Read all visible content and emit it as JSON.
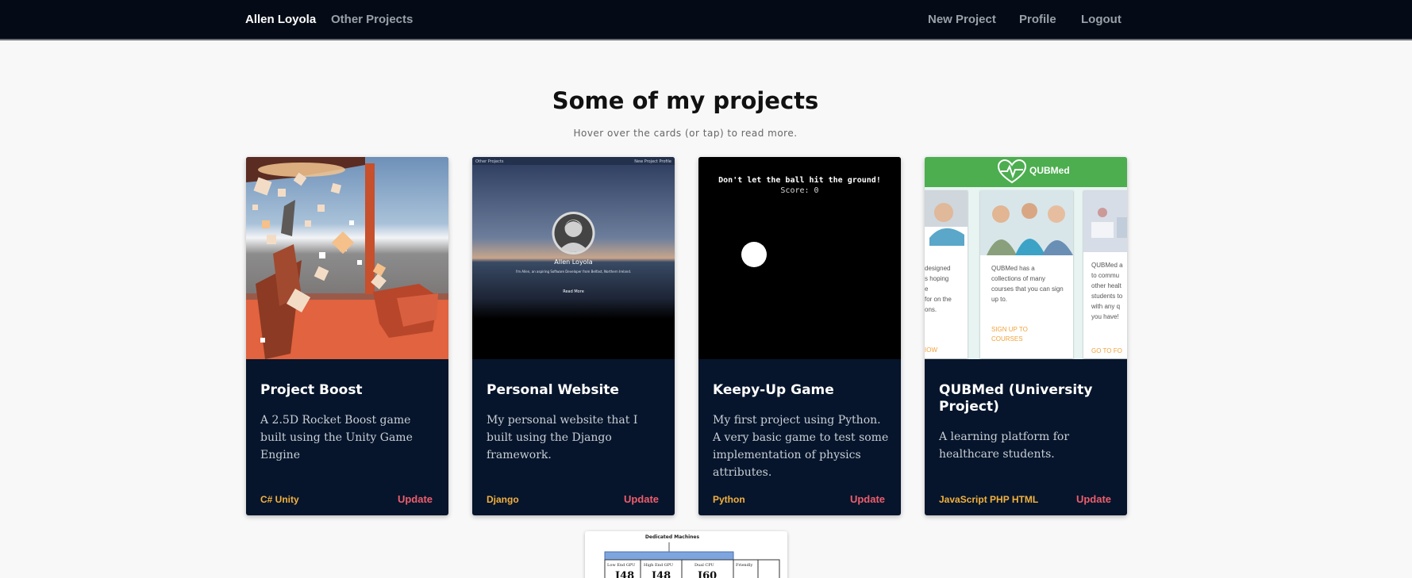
{
  "nav": {
    "brand": "Allen Loyola",
    "other_projects": "Other Projects",
    "new_project": "New Project",
    "profile": "Profile",
    "logout": "Logout"
  },
  "section": {
    "title": "Some of my projects",
    "subtitle": "Hover over the cards (or tap) to read more."
  },
  "cards": [
    {
      "title": "Project Boost",
      "description": "A 2.5D Rocket Boost game built using the Unity Game Engine",
      "tags": "C# Unity",
      "update": "Update"
    },
    {
      "title": "Personal Website",
      "description": "My personal website that I built using the Django framework.",
      "tags": "Django",
      "update": "Update",
      "preview": {
        "nav_left": "Other Projects",
        "nav_right": "New Project  Profile",
        "name": "Allen Loyola",
        "tagline": "I'm Allen, an aspiring Software Developer from Belfast, Northern Ireland.",
        "button": "Read More"
      }
    },
    {
      "title": "Keepy-Up Game",
      "description": "My first project using Python. A very basic game to test some implementation of physics attributes.",
      "tags": "Python",
      "update": "Update",
      "preview": {
        "message": "Don't let the ball hit the ground!",
        "score": "Score: 0"
      }
    },
    {
      "title": "QUBMed (University Project)",
      "description": "A learning platform for healthcare students.",
      "tags": "JavaScript PHP HTML",
      "update": "Update",
      "preview": {
        "logo": "QUBMed",
        "left_text": "designed\ns hoping\ne\nfor on the\nons.",
        "left_link": "IOW",
        "mid_text": "QUBMed has a collections of many courses that you can sign up to.",
        "mid_link": "SIGN UP TO COURSES",
        "right_text": "QUBMed a\nto commu\nother healt\nstudents to\nwith any q\nyou have!",
        "right_link": "GO TO FO"
      }
    }
  ],
  "partial_card": {
    "heading": "Dedicated Machines",
    "cells": [
      "Low End GPU",
      "High End GPU",
      "Dual CPU",
      "Friendly"
    ],
    "values": [
      "I48",
      "I48",
      "I60"
    ]
  },
  "colors": {
    "navbar": "#050b16",
    "card": "#06152b",
    "tag": "#f3b13d",
    "update": "#ee5d6c",
    "qubmed_green": "#4cae4f"
  }
}
